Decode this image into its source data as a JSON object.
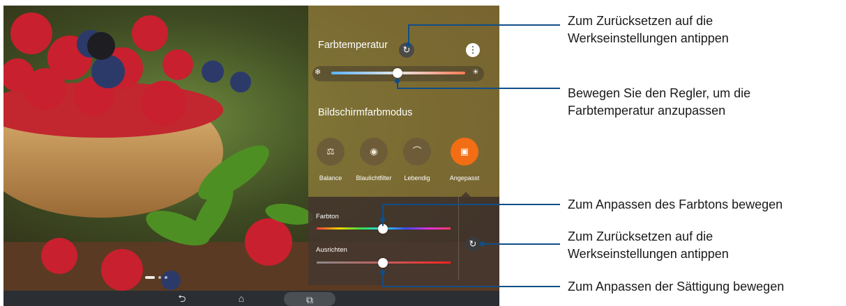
{
  "colors": {
    "accent": "#f36d14",
    "leader_line": "#0f4e88"
  },
  "color_temperature": {
    "title": "Farbtemperatur",
    "reset_icon": "reset-icon",
    "more_icon": "more-vertical-icon",
    "cold_icon": "snowflake-icon",
    "warm_icon": "sun-icon",
    "slider_value_fraction": 0.5
  },
  "display_mode": {
    "title": "Bildschirmfarbmodus",
    "modes": [
      {
        "label": "Balance",
        "icon": "balance-scale-icon"
      },
      {
        "label": "Blaulichtfilter",
        "icon": "eye-shield-icon"
      },
      {
        "label": "Lebendig",
        "icon": "rainbow-icon"
      },
      {
        "label": "Angepasst",
        "icon": "custom-settings-icon",
        "selected": true
      }
    ]
  },
  "custom": {
    "hue_label": "Farbton",
    "hue_value_fraction": 0.5,
    "saturation_label": "Ausrichten",
    "saturation_value_fraction": 0.5,
    "reset_icon": "reset-icon"
  },
  "navbar": {
    "back_icon": "back-icon",
    "home_icon": "home-icon",
    "recent_icon": "recent-apps-icon"
  },
  "callouts": {
    "reset_temp": [
      "Zum Zurücksetzen auf die",
      "Werkseinstellungen antippen"
    ],
    "move_slider": [
      "Bewegen Sie den Regler, um die",
      "Farbtemperatur anzupassen"
    ],
    "hue": [
      "Zum Anpassen des Farbtons bewegen"
    ],
    "reset_custom": [
      "Zum Zurücksetzen auf die",
      "Werkseinstellungen antippen"
    ],
    "saturation": [
      "Zum Anpassen der Sättigung bewegen"
    ]
  }
}
